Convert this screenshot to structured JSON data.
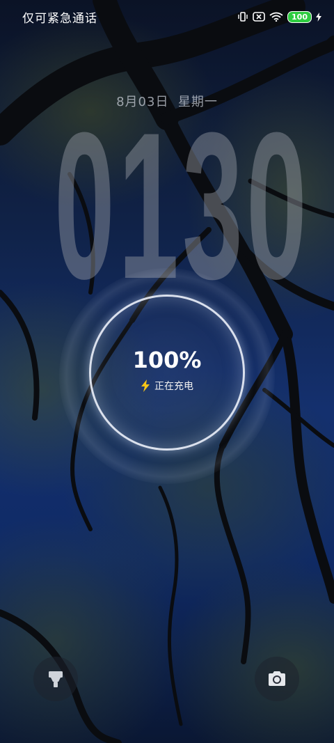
{
  "status_bar": {
    "carrier_text": "仅可紧急通话",
    "battery_level": "100",
    "icons": [
      "vibrate-icon",
      "no-sim-icon",
      "wifi-icon",
      "battery-icon",
      "charging-bolt-icon"
    ],
    "battery_color": "#2ecc40"
  },
  "lockscreen": {
    "date": "8月03日",
    "weekday": "星期一",
    "clock": {
      "h1": "0",
      "h2": "1",
      "m1": "3",
      "m2": "0"
    }
  },
  "charging": {
    "percent": "100%",
    "status": "正在充电",
    "bolt_color": "#f5c518"
  },
  "shortcuts": {
    "left_icon": "flashlight-icon",
    "right_icon": "camera-icon"
  }
}
